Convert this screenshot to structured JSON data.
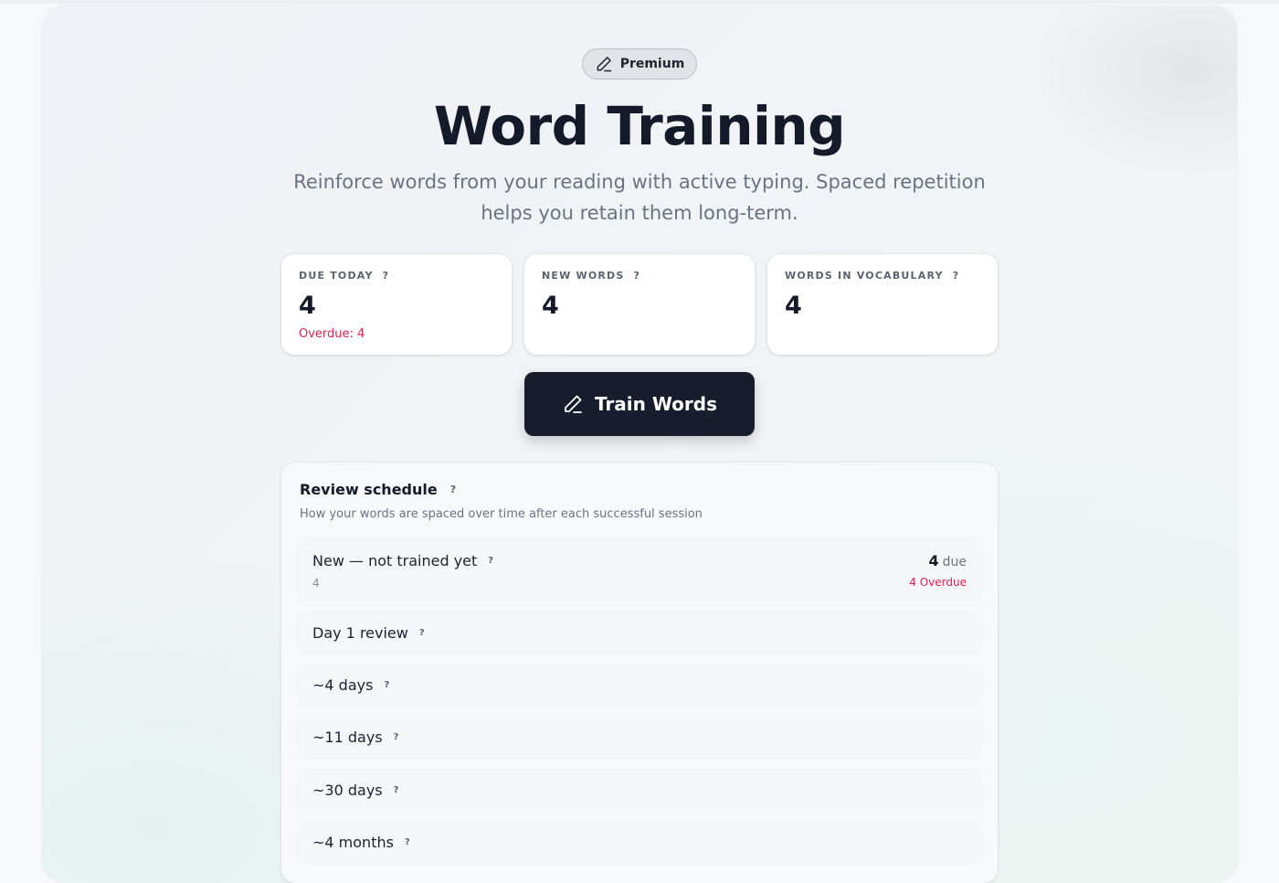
{
  "badge": {
    "label": "Premium",
    "icon": "pencil-icon"
  },
  "header": {
    "title": "Word Training",
    "subtitle": "Reinforce words from your reading with active typing. Spaced repetition helps you retain them long-term."
  },
  "stats": [
    {
      "label": "DUE TODAY",
      "help": "?",
      "value": "4",
      "sub": "Overdue: 4"
    },
    {
      "label": "NEW WORDS",
      "help": "?",
      "value": "4"
    },
    {
      "label": "WORDS IN VOCABULARY",
      "help": "?",
      "value": "4"
    }
  ],
  "train_button": {
    "label": "Train Words",
    "icon": "pencil-icon"
  },
  "schedule": {
    "title": "Review schedule",
    "help": "?",
    "description": "How your words are spaced over time after each successful session",
    "rows": [
      {
        "label": "New — not trained yet",
        "help": "?",
        "count": "4",
        "due_count": "4",
        "due_suffix": "due",
        "overdue": "4 Overdue"
      },
      {
        "label": "Day 1 review",
        "help": "?"
      },
      {
        "label": "~4 days",
        "help": "?"
      },
      {
        "label": "~11 days",
        "help": "?"
      },
      {
        "label": "~30 days",
        "help": "?"
      },
      {
        "label": "~4 months",
        "help": "?"
      }
    ]
  },
  "colors": {
    "accent_dark": "#171d2c",
    "overdue_red": "#e0244f"
  }
}
